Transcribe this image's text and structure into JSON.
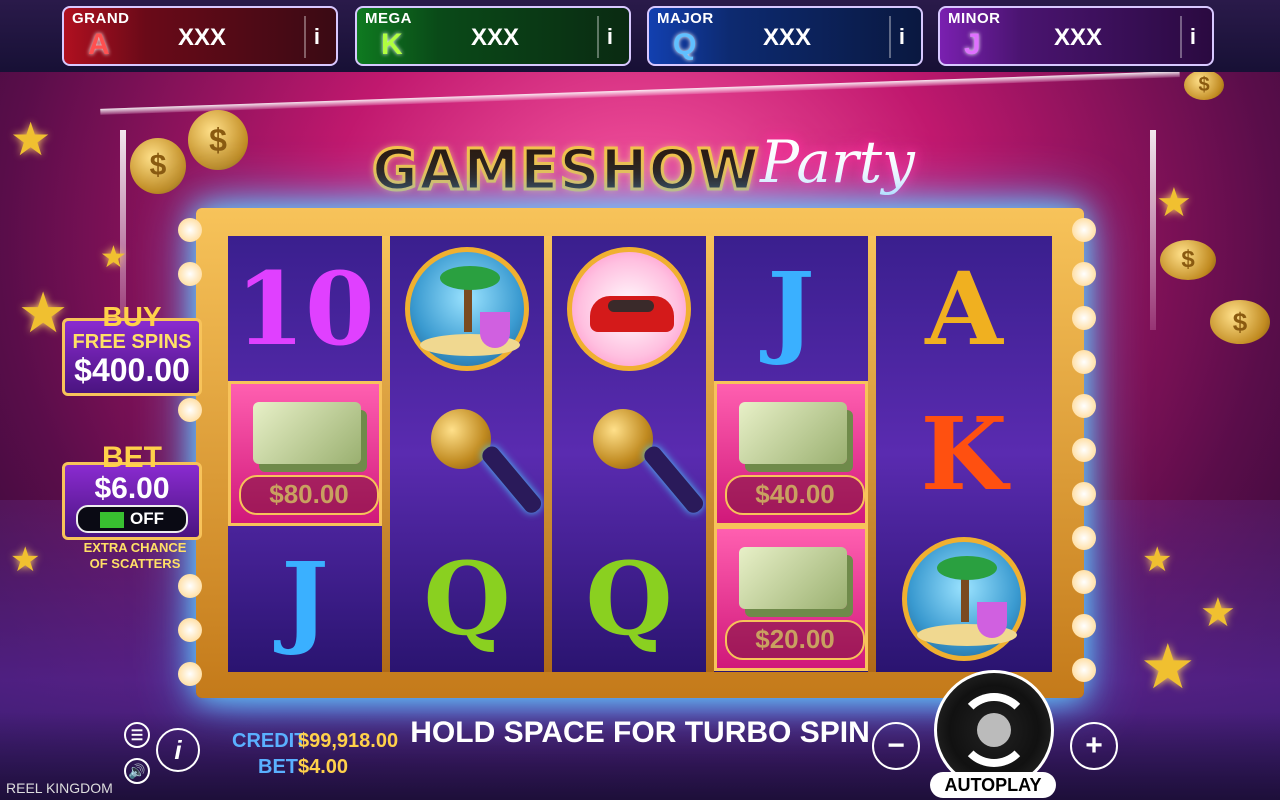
{
  "jackpots": [
    {
      "label": "GRAND",
      "letter": "A",
      "value": "XXX",
      "info": "i"
    },
    {
      "label": "MEGA",
      "letter": "K",
      "value": "XXX",
      "info": "i"
    },
    {
      "label": "MAJOR",
      "letter": "Q",
      "value": "XXX",
      "info": "i"
    },
    {
      "label": "MINOR",
      "letter": "J",
      "value": "XXX",
      "info": "i"
    }
  ],
  "logo": {
    "main": "GAMESHOW",
    "script": "Party"
  },
  "reels": {
    "col1": {
      "top": "10",
      "mid_amount": "$80.00",
      "bottom": "J"
    },
    "col2": {
      "mid": "microphone",
      "bottom": "Q"
    },
    "col3": {
      "mid": "microphone",
      "bottom": "Q"
    },
    "col4": {
      "top": "J",
      "mid_amount": "$40.00",
      "bottom_amount": "$20.00"
    },
    "col5": {
      "top": "A",
      "mid": "K"
    }
  },
  "buy": {
    "title": "BUY",
    "sub": "FREE SPINS",
    "value": "$400.00"
  },
  "bet_panel": {
    "title": "BET",
    "value": "$6.00",
    "toggle": "OFF",
    "extra_line1": "EXTRA CHANCE",
    "extra_line2": "OF SCATTERS"
  },
  "bottom": {
    "turbo": "HOLD SPACE FOR TURBO SPIN",
    "credit_label": "CREDIT",
    "credit_value": "$99,918.00",
    "bet_label": "BET",
    "bet_value": "$4.00",
    "autoplay": "AUTOPLAY",
    "brand": "REEL KINGDOM",
    "minus": "−",
    "plus": "+",
    "info": "i"
  },
  "icons": {
    "menu": "menu-icon",
    "sound": "sound-icon",
    "info": "info-icon",
    "spin": "spin-icon"
  }
}
